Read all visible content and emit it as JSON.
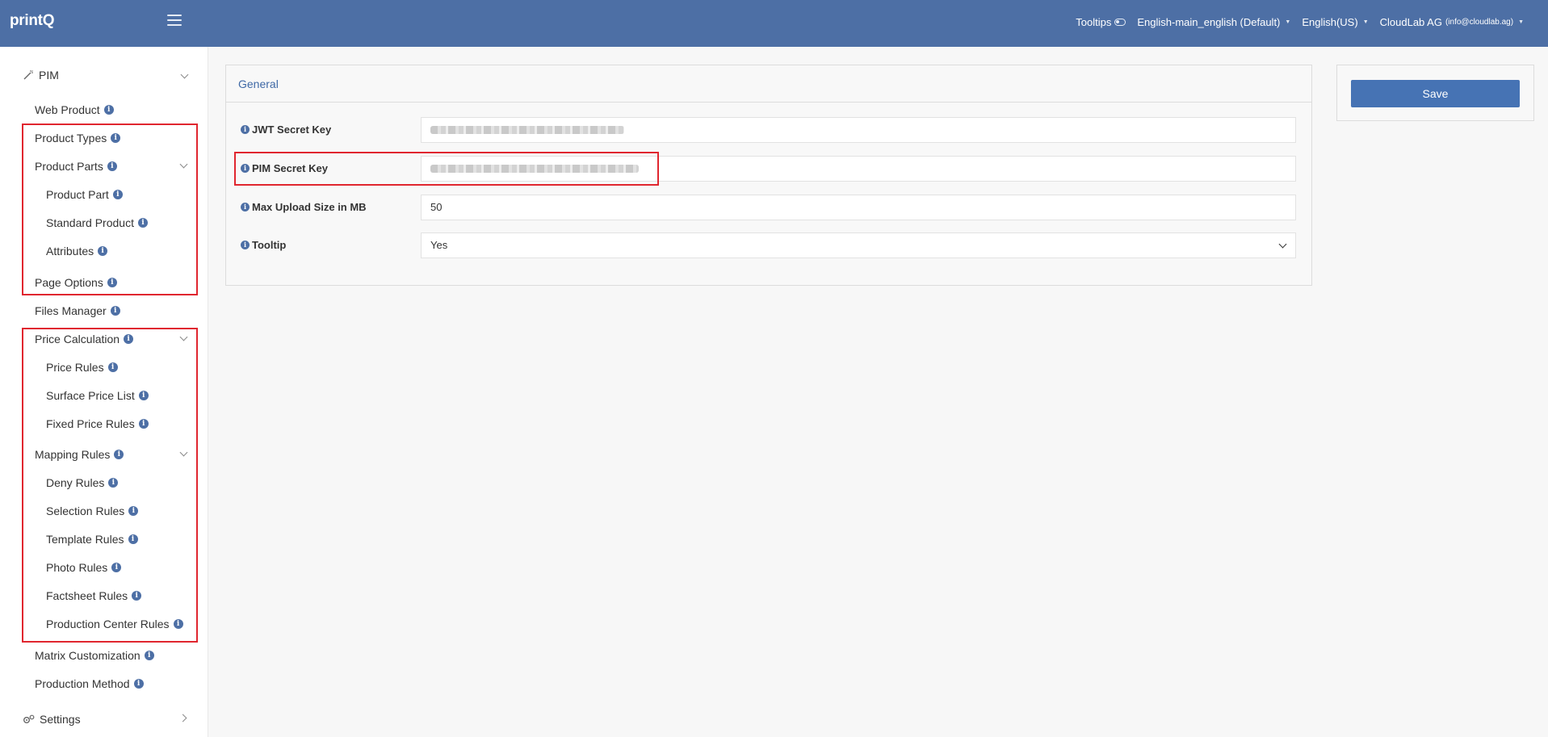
{
  "app": {
    "logo": "printQ"
  },
  "topnav": {
    "tooltips_label": "Tooltips",
    "store": "English-main_english (Default)",
    "locale": "English(US)",
    "user_name": "CloudLab AG",
    "user_email": "(info@cloudlab.ag)"
  },
  "sidebar": {
    "section": "PIM",
    "items": {
      "web_product": "Web Product",
      "product_types": "Product Types",
      "product_parts": "Product Parts",
      "product_part": "Product Part",
      "standard_product": "Standard Product",
      "attributes": "Attributes",
      "page_options": "Page Options",
      "files_manager": "Files Manager",
      "price_calculation": "Price Calculation",
      "price_rules": "Price Rules",
      "surface_price_list": "Surface Price List",
      "fixed_price_rules": "Fixed Price Rules",
      "mapping_rules": "Mapping Rules",
      "deny_rules": "Deny Rules",
      "selection_rules": "Selection Rules",
      "template_rules": "Template Rules",
      "photo_rules": "Photo Rules",
      "factsheet_rules": "Factsheet Rules",
      "production_center_rules": "Production Center Rules",
      "matrix_customization": "Matrix Customization",
      "production_method": "Production Method",
      "settings": "Settings"
    }
  },
  "form": {
    "title": "General",
    "jwt_label": "JWT Secret Key",
    "pim_label": "PIM Secret Key",
    "upload_label": "Max Upload Size in MB",
    "upload_value": "50",
    "tooltip_label": "Tooltip",
    "tooltip_value": "Yes"
  },
  "actions": {
    "save": "Save"
  },
  "colors": {
    "topbar": "#4d6fa5",
    "accent": "#4673b4",
    "highlight_box": "#e0262f",
    "info_icon": "#4d6fa5"
  }
}
